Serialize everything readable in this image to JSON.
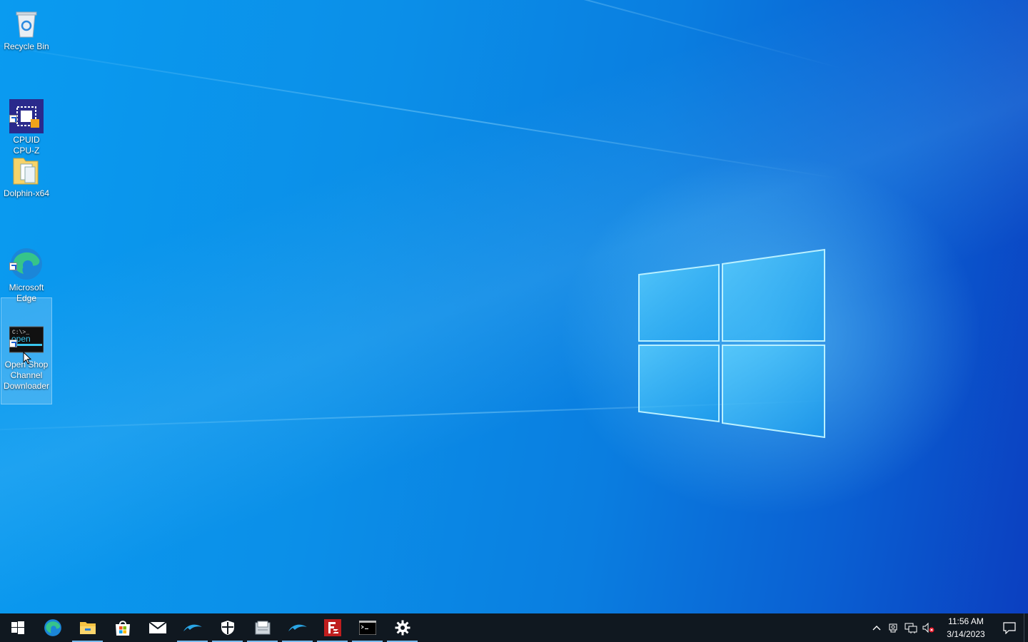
{
  "desktop": {
    "icons": [
      {
        "label": "Recycle Bin",
        "icon": "recycle-bin-icon",
        "shortcut": false
      },
      {
        "label": "CPUID\nCPU-Z",
        "icon": "cpu-z-icon",
        "shortcut": true
      },
      {
        "label": "Dolphin-x64",
        "icon": "folder-icon",
        "shortcut": false
      },
      {
        "label": "Microsoft\nEdge",
        "icon": "edge-icon",
        "shortcut": true
      },
      {
        "label": "Open Shop\nChannel\nDownloader",
        "icon": "osc-downloader-icon",
        "shortcut": true,
        "selected": true
      }
    ]
  },
  "osc_icon_text": {
    "prompt": "C:\\>_",
    "word": "open"
  },
  "taskbar": {
    "items": [
      {
        "name": "start-button",
        "icon": "windows-start-icon"
      },
      {
        "name": "edge",
        "icon": "edge-icon"
      },
      {
        "name": "file-explorer",
        "icon": "file-explorer-icon",
        "running": true
      },
      {
        "name": "microsoft-store",
        "icon": "store-icon"
      },
      {
        "name": "mail",
        "icon": "mail-icon"
      },
      {
        "name": "dolphin",
        "icon": "dolphin-icon",
        "running": true
      },
      {
        "name": "windows-security",
        "icon": "shield-icon",
        "running": true
      },
      {
        "name": "app",
        "icon": "scanner-icon",
        "running": true
      },
      {
        "name": "dolphin-2",
        "icon": "dolphin-icon",
        "running": true
      },
      {
        "name": "filezilla",
        "icon": "filezilla-icon",
        "running": true
      },
      {
        "name": "command-prompt",
        "icon": "terminal-icon",
        "running": true
      },
      {
        "name": "settings",
        "icon": "gear-icon",
        "running": true
      }
    ],
    "tray": {
      "time": "11:56 AM",
      "date": "3/14/2023"
    }
  },
  "colors": {
    "taskbar": "#101820",
    "accent": "#76b9ed"
  }
}
